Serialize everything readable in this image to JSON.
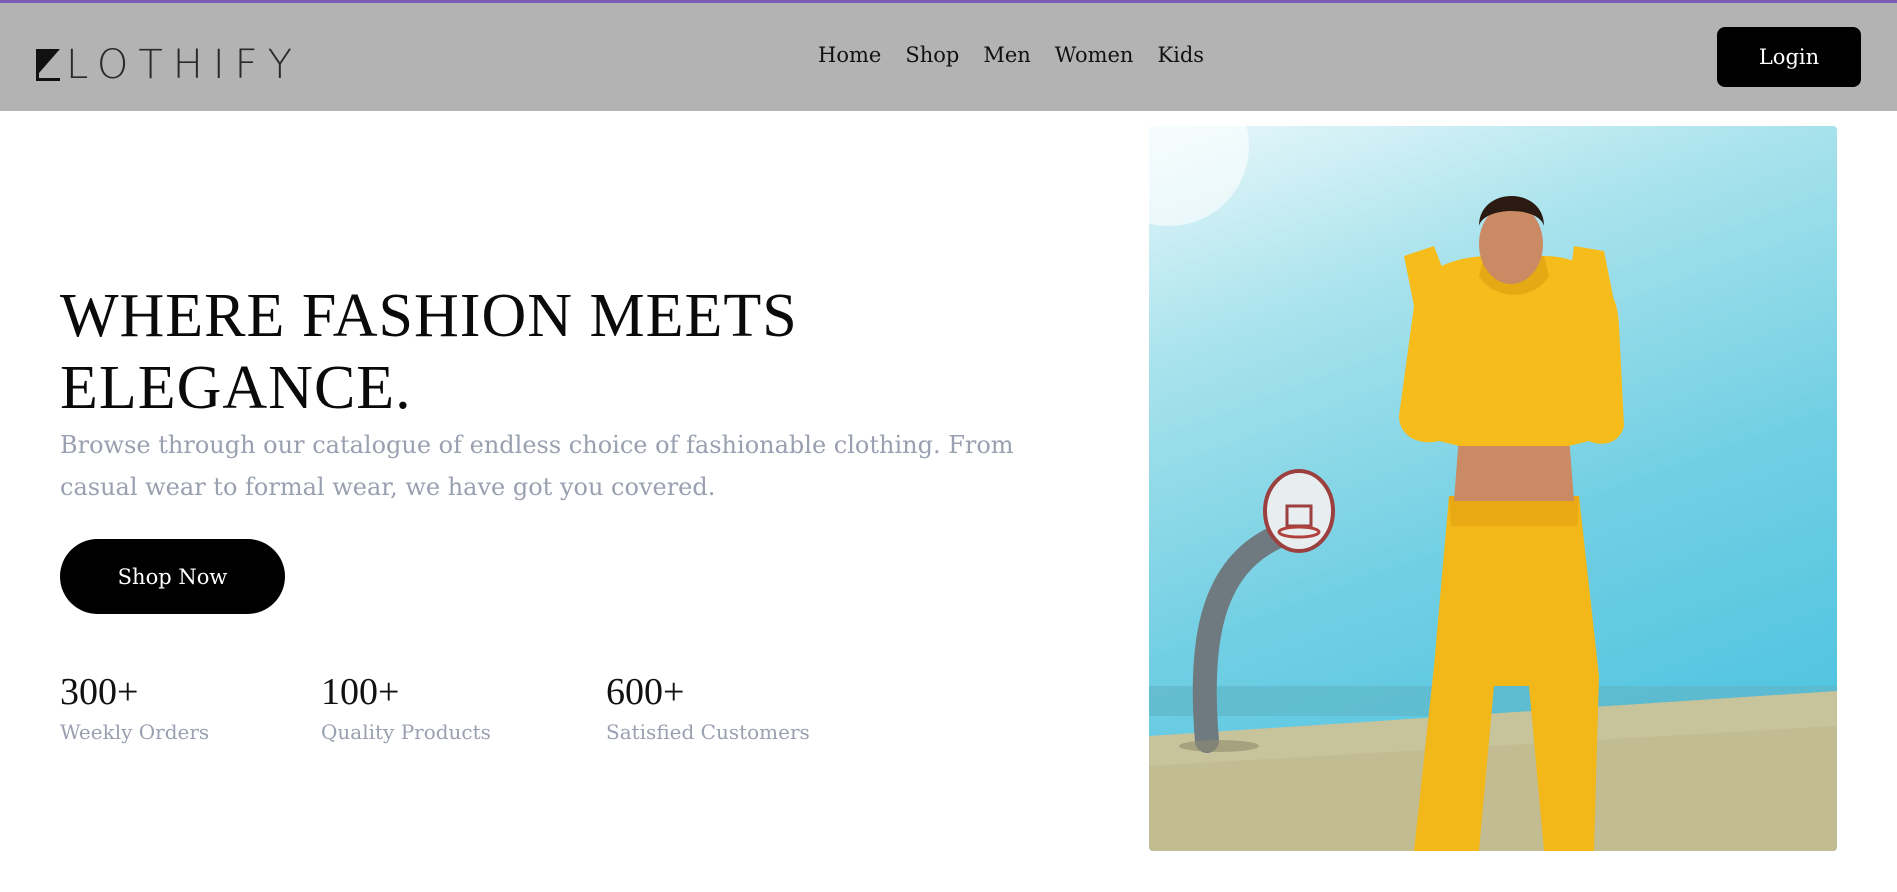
{
  "brand": {
    "name": "LOTHIFY"
  },
  "nav": {
    "links": [
      "Home",
      "Shop",
      "Men",
      "Women",
      "Kids"
    ],
    "login_label": "Login"
  },
  "hero": {
    "title": "WHERE FASHION MEETS ELEGANCE.",
    "subtitle": "Browse through our catalogue of endless choice of fashionable clothing. From casual wear to formal wear, we have got you covered.",
    "cta_label": "Shop Now",
    "stats": [
      {
        "value": "300+",
        "label": "Weekly Orders"
      },
      {
        "value": "100+",
        "label": "Quality Products"
      },
      {
        "value": "600+",
        "label": "Satisfied Customers"
      }
    ]
  },
  "colors": {
    "accent_line": "#7a5fb3",
    "navbar_bg": "#b3b3b3",
    "button_bg": "#000000",
    "muted_text": "#9aa0b0"
  }
}
